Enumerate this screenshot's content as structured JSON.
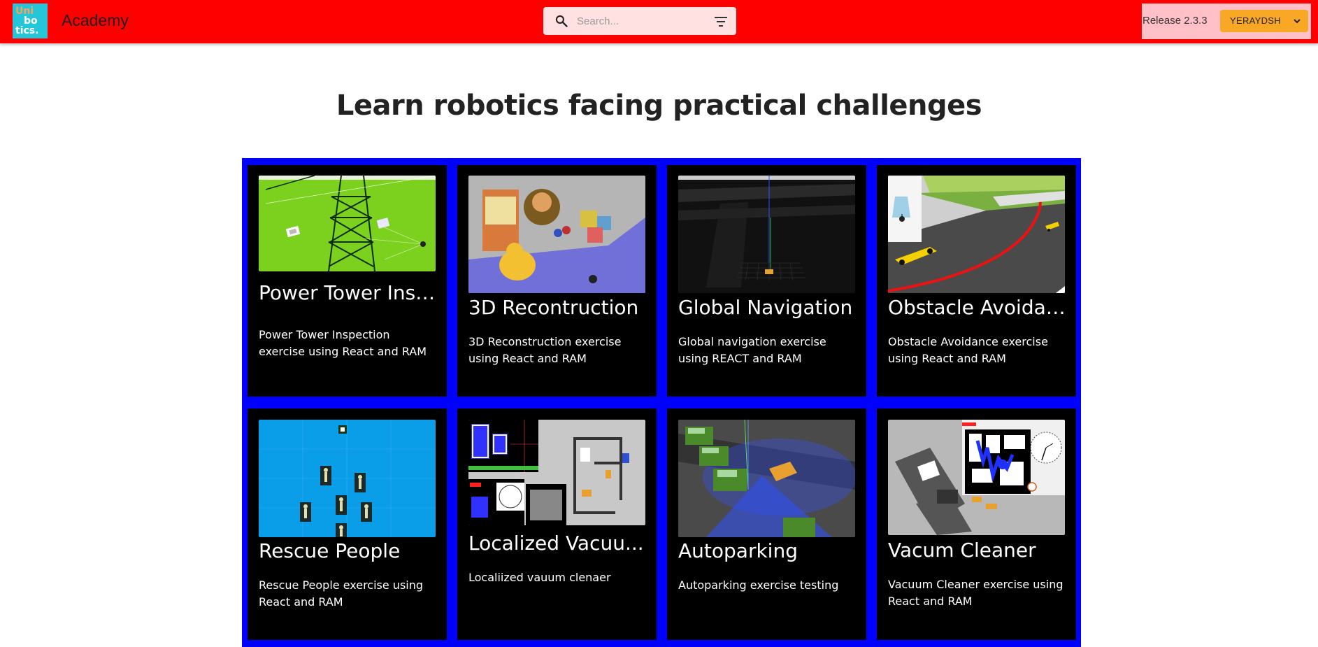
{
  "header": {
    "logo": {
      "line1": "Uni",
      "line2": "bo",
      "line3": "tics."
    },
    "title": "Academy",
    "search": {
      "placeholder": "Search...",
      "value": "",
      "icon": "search-icon",
      "filter_icon": "filter-icon"
    },
    "release": "Release 2.3.3",
    "user_button": {
      "label": "YERAYDSH",
      "icon": "chevron-down-icon"
    }
  },
  "hero": {
    "title": "Learn robotics facing practical challenges"
  },
  "exercises": [
    {
      "title": "Power Tower Insp...",
      "description": "Power Tower Inspection exercise using React and RAM"
    },
    {
      "title": "3D Recontruction",
      "description": "3D Reconstruction exercise using React and RAM"
    },
    {
      "title": "Global Navigation",
      "description": "Global navigation exercise using REACT and RAM"
    },
    {
      "title": "Obstacle Avoidan...",
      "description": "Obstacle Avoidance exercise using React and RAM"
    },
    {
      "title": "Rescue People",
      "description": "Rescue People exercise using React and RAM"
    },
    {
      "title": "Localized Vacuu...",
      "description": "Localiized vauum clenaer"
    },
    {
      "title": "Autoparking",
      "description": "Autoparking exercise testing"
    },
    {
      "title": "Vacum Cleaner",
      "description": "Vacuum Cleaner exercise using React and RAM"
    }
  ],
  "colors": {
    "appbar": "#ff0000",
    "grid_background": "#0000ff",
    "card_background": "#000000",
    "user_button": "#f9a825",
    "search_background": "#ffe1e1",
    "logo_background": "#26c6da"
  }
}
